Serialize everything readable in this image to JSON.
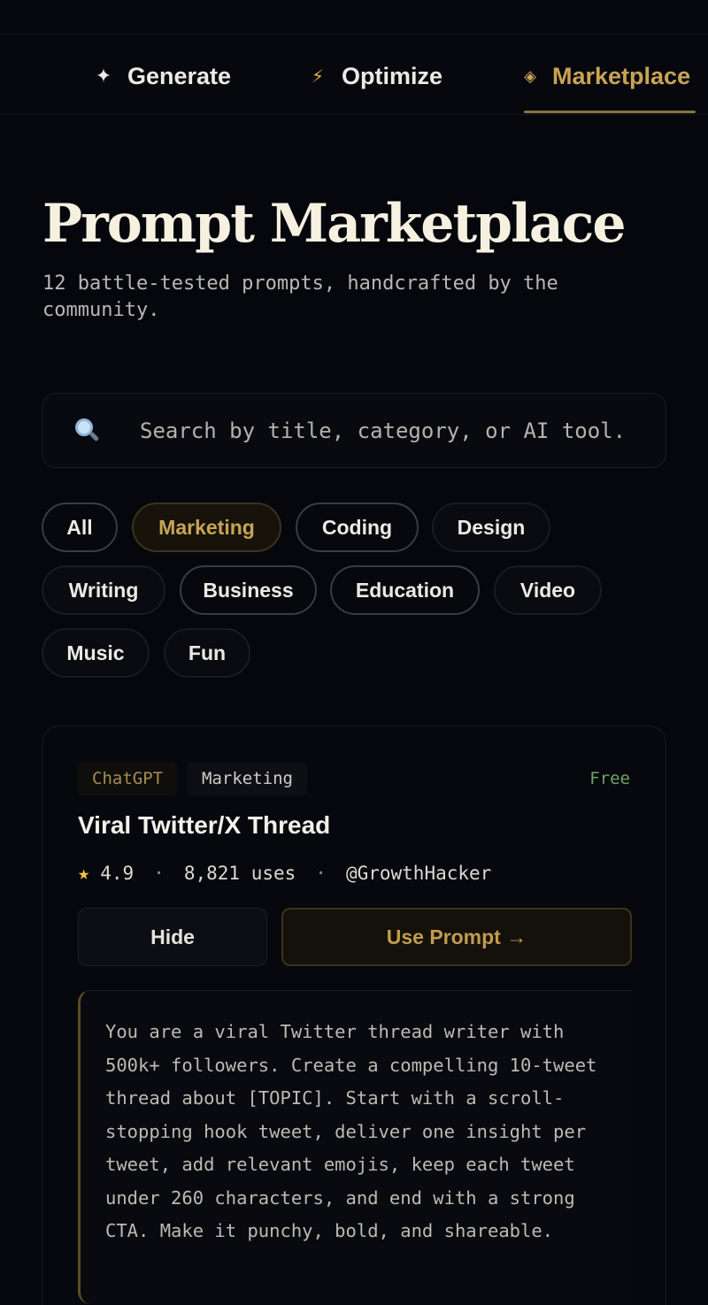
{
  "nav": {
    "tabs": [
      {
        "label": "Generate",
        "icon": "sparkle-icon",
        "glyph": "✦"
      },
      {
        "label": "Optimize",
        "icon": "lightning-icon",
        "glyph": "⚡"
      },
      {
        "label": "Marketplace",
        "icon": "diamond-icon",
        "glyph": "◈"
      }
    ],
    "active": "Marketplace"
  },
  "hero": {
    "title": "Prompt Marketplace",
    "subtitle": "12 battle-tested prompts, handcrafted by the community."
  },
  "search": {
    "placeholder": "Search by title, category, or AI tool.",
    "value": ""
  },
  "filters": {
    "categories": [
      "All",
      "Marketing",
      "Coding",
      "Design",
      "Writing",
      "Business",
      "Education",
      "Video",
      "Music",
      "Fun"
    ],
    "selected": "Marketing"
  },
  "card": {
    "tool": "ChatGPT",
    "category": "Marketing",
    "price": "Free",
    "title": "Viral Twitter/X Thread",
    "rating": "4.9",
    "uses": "8,821 uses",
    "author": "@GrowthHacker",
    "hide_label": "Hide",
    "use_label": "Use Prompt →",
    "prompt_text": "You are a viral Twitter thread writer with 500k+ followers. Create a compelling 10-tweet thread about [TOPIC]. Start with a scroll-stopping hook tweet, deliver one insight per tweet, add relevant emojis, keep each tweet under 260 characters, and end with a strong CTA. Make it punchy, bold, and shareable."
  },
  "colors": {
    "accent": "#c9a355",
    "background": "#06070c",
    "free": "#6fa363",
    "star": "#f3c33c"
  }
}
